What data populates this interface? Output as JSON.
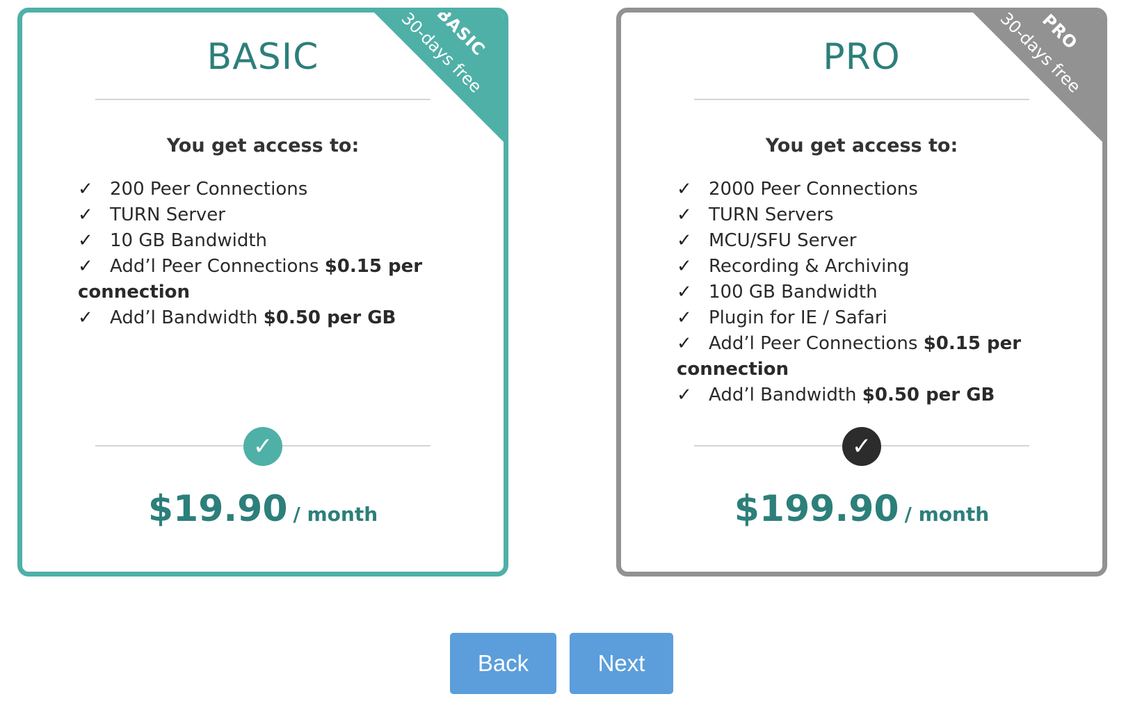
{
  "colors": {
    "teal": "#4fb0a7",
    "grey": "#929292",
    "price_text": "#2c7f7a",
    "button": "#5b9edb"
  },
  "plans": [
    {
      "title": "BASIC",
      "ribbon_name": "BASIC",
      "ribbon_sub": "30-days free",
      "access_title": "You get access to:",
      "features": [
        {
          "check": "✓",
          "text": "200 Peer Connections",
          "bold": ""
        },
        {
          "check": "✓",
          "text": "TURN Server",
          "bold": ""
        },
        {
          "check": "✓",
          "text": "10 GB Bandwidth",
          "bold": ""
        },
        {
          "check": "✓",
          "text": "Add’l Peer Connections ",
          "bold": "$0.15 per connection"
        },
        {
          "check": "✓",
          "text": "Add’l Bandwidth ",
          "bold": "$0.50 per GB"
        }
      ],
      "status_icon": "✓",
      "price": "$19.90",
      "period": "/ month"
    },
    {
      "title": "PRO",
      "ribbon_name": "PRO",
      "ribbon_sub": "30-days free",
      "access_title": "You get access to:",
      "features": [
        {
          "check": "✓",
          "text": "2000 Peer Connections",
          "bold": ""
        },
        {
          "check": "✓",
          "text": "TURN Servers",
          "bold": ""
        },
        {
          "check": "✓",
          "text": "MCU/SFU Server",
          "bold": ""
        },
        {
          "check": "✓",
          "text": "Recording & Archiving",
          "bold": ""
        },
        {
          "check": "✓",
          "text": "100 GB Bandwidth",
          "bold": ""
        },
        {
          "check": "✓",
          "text": "Plugin for IE / Safari",
          "bold": ""
        },
        {
          "check": "✓",
          "text": "Add’l Peer Connections ",
          "bold": "$0.15 per connection"
        },
        {
          "check": "✓",
          "text": "Add’l Bandwidth ",
          "bold": "$0.50 per GB"
        }
      ],
      "status_icon": "✓",
      "price": "$199.90",
      "period": "/ month"
    }
  ],
  "buttons": {
    "back": "Back",
    "next": "Next"
  }
}
